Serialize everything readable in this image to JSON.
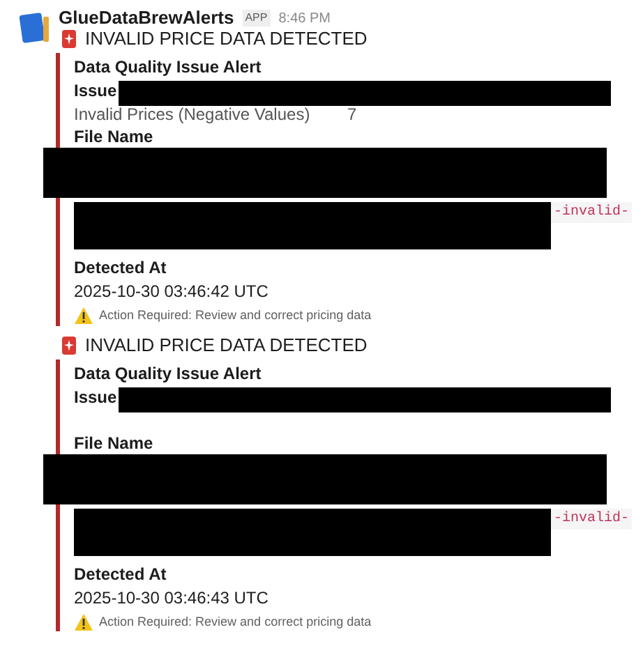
{
  "message": {
    "sender": "GlueDataBrewAlerts",
    "badge": "APP",
    "time": "8:46 PM"
  },
  "attachments": [
    {
      "title": "INVALID PRICE DATA DETECTED",
      "heading": "Data Quality Issue Alert",
      "issue_label": "Issue",
      "issue_value": "Invalid Prices (Negative Values)",
      "count": "7",
      "file_label": "File Name",
      "file_fragment": "-invalid-",
      "detected_label": "Detected At",
      "detected_at": "2025-10-30 03:46:42 UTC",
      "footer": "Action Required: Review and correct pricing data"
    },
    {
      "title": "INVALID PRICE DATA DETECTED",
      "heading": "Data Quality Issue Alert",
      "issue_label": "Issue",
      "file_label": "File Name",
      "file_fragment": "-invalid-",
      "detected_label": "Detected At",
      "detected_at": "2025-10-30 03:46:43 UTC",
      "footer": "Action Required: Review and correct pricing data"
    }
  ]
}
